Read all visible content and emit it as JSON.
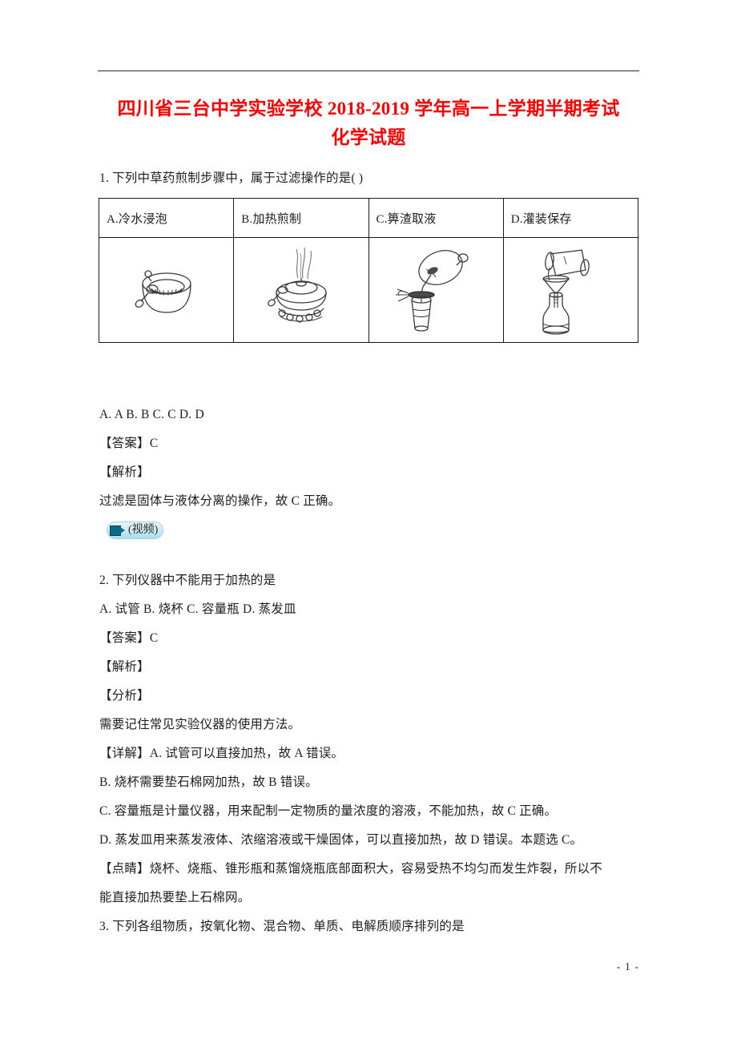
{
  "document": {
    "title_line1": "四川省三台中学实验学校 2018-2019 学年高一上学期半期考试",
    "title_line2": "化学试题",
    "title_color": "#ff0000",
    "page_number": "- 1 -"
  },
  "question1": {
    "stem": "1. 下列中草药煎制步骤中，属于过滤操作的是(        )",
    "table": {
      "headers": [
        "A.冷水浸泡",
        "B.加热煎制",
        "C.箅渣取液",
        "D.灌装保存"
      ],
      "illustrations": [
        "pot-soaking-icon",
        "pot-heating-icon",
        "pouring-through-strainer-icon",
        "funnel-bottling-icon"
      ]
    },
    "options": "A.  A        B. B        C. C        D. D",
    "answer_label": "【答案】",
    "answer_value": "C",
    "analysis_label": "【解析】",
    "analysis_text": "过滤是固体与液体分离的操作，故 C 正确。",
    "video_badge": {
      "icon": "camcorder-icon",
      "text": "(视频)"
    }
  },
  "question2": {
    "stem": "2. 下列仪器中不能用于加热的是",
    "options": "A.  试管      B.  烧杯      C.  容量瓶      D.  蒸发皿",
    "answer_label": "【答案】",
    "answer_value": "C",
    "analysis_label": "【解析】",
    "fenxi_label": "【分析】",
    "fenxi_text": "需要记住常见实验仪器的使用方法。",
    "detail_line_a": "【详解】A. 试管可以直接加热，故 A 错误。",
    "detail_line_b": "B. 烧杯需要垫石棉网加热，故 B 错误。",
    "detail_line_c": "C. 容量瓶是计量仪器，用来配制一定物质的量浓度的溶液，不能加热，故 C 正确。",
    "detail_line_d": "D. 蒸发皿用来蒸发液体、浓缩溶液或干燥固体，可以直接加热，故 D 错误。本题选 C。",
    "dianjing_line1": "【点睛】烧杯、烧瓶、锥形瓶和蒸馏烧瓶底部面积大，容易受热不均匀而发生炸裂，所以不",
    "dianjing_line2": "能直接加热要垫上石棉网。"
  },
  "question3": {
    "stem": "3. 下列各组物质，按氧化物、混合物、单质、电解质顺序排列的是"
  }
}
